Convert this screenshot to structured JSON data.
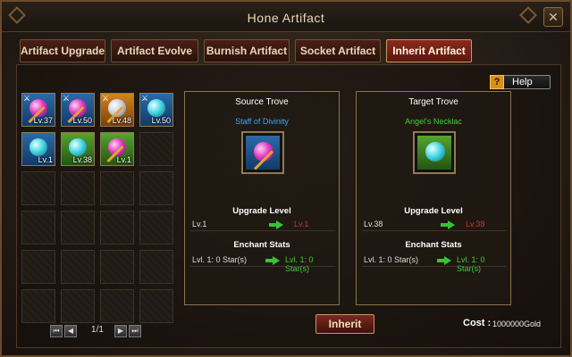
{
  "window": {
    "title": "Hone Artifact",
    "close_label": "✕"
  },
  "tabs": [
    {
      "label": "Artifact Upgrade",
      "active": false
    },
    {
      "label": "Artifact Evolve",
      "active": false
    },
    {
      "label": "Burnish Artifact",
      "active": false
    },
    {
      "label": "Socket Artifact",
      "active": false
    },
    {
      "label": "Inherit Artifact",
      "active": true
    }
  ],
  "help": {
    "label": "Help",
    "icon": "question-icon",
    "glyph": "?"
  },
  "inventory": {
    "items": [
      {
        "icon": "staff-pink-orb-icon",
        "level": "Lv.37",
        "locked": true
      },
      {
        "icon": "staff-pink-orb-icon",
        "level": "Lv.50",
        "locked": true
      },
      {
        "icon": "wand-silver-orb-icon",
        "level": "Lv.48",
        "locked": true
      },
      {
        "icon": "necklace-cyan-icon",
        "level": "Lv.50",
        "locked": true
      },
      {
        "icon": "necklace-cyan-icon",
        "level": "Lv.1",
        "locked": false
      },
      {
        "icon": "necklace-cyan-icon",
        "level": "Lv.38",
        "locked": false
      },
      {
        "icon": "staff-pink-orb-icon",
        "level": "Lv.1",
        "locked": false
      }
    ],
    "lock_glyph": "⚔",
    "pager": {
      "first": "⏮",
      "prev": "◀",
      "page": "1/1",
      "next": "▶",
      "last": "⏭"
    }
  },
  "source": {
    "title": "Source Trove",
    "item_name": "Staff of Divinity",
    "item_color": "#3aa6ff",
    "upgrade_label": "Upgrade Level",
    "level_from": "Lv.1",
    "level_to": "Lv.1",
    "enchant_label": "Enchant Stats",
    "stars_from": "Lvl. 1: 0 Star(s)",
    "stars_to": "Lvl. 1: 0 Star(s)"
  },
  "target": {
    "title": "Target Trove",
    "item_name": "Angel's Necklac",
    "item_color": "#3bd13b",
    "upgrade_label": "Upgrade Level",
    "level_from": "Lv.38",
    "level_to": "Lv.38",
    "enchant_label": "Enchant Stats",
    "stars_from": "Lvl. 1: 0 Star(s)",
    "stars_to": "Lvl. 1: 0 Star(s)"
  },
  "inherit_button": "Inherit",
  "cost": {
    "label": "Cost :",
    "value": "1000000Gold"
  }
}
